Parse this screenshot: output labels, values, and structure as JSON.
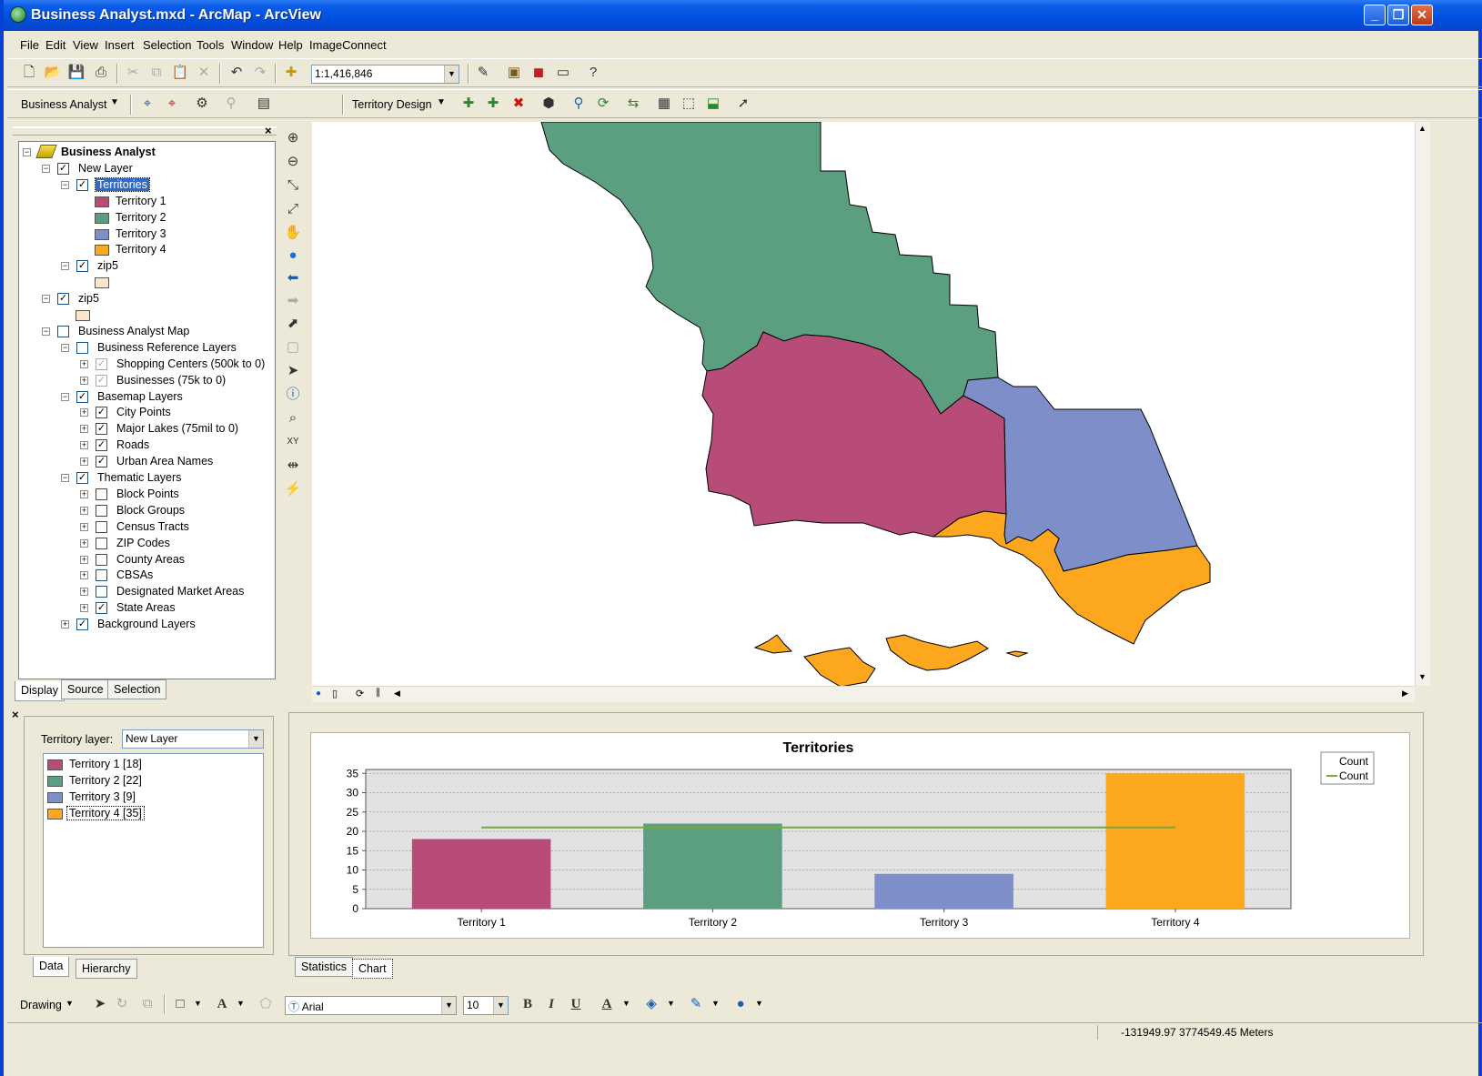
{
  "window": {
    "title": "Business Analyst.mxd - ArcMap - ArcView",
    "min": "_",
    "max": "❐",
    "close": "✕"
  },
  "menu": [
    "File",
    "Edit",
    "View",
    "Insert",
    "Selection",
    "Tools",
    "Window",
    "Help",
    "ImageConnect"
  ],
  "toolbar": {
    "scale": "1:1,416,846"
  },
  "ba_toolbar": {
    "label": "Business Analyst",
    "territory_design": "Territory Design"
  },
  "toc": {
    "rows": [
      {
        "indent": 0,
        "exp": "−",
        "chk": null,
        "icon": "layers",
        "label": "Business Analyst",
        "bold": true
      },
      {
        "indent": 1,
        "exp": "−",
        "chk": "checked",
        "label": "New Layer"
      },
      {
        "indent": 2,
        "exp": "−",
        "chk": "checked",
        "label": "Territories",
        "selected": true
      },
      {
        "indent": 3,
        "swatch": "#b84c78",
        "label": "Territory 1"
      },
      {
        "indent": 3,
        "swatch": "#5c9e80",
        "label": "Territory 2"
      },
      {
        "indent": 3,
        "swatch": "#7d8ec8",
        "label": "Territory 3"
      },
      {
        "indent": 3,
        "swatch": "#fca71d",
        "label": "Territory 4"
      },
      {
        "indent": 2,
        "exp": "−",
        "chk": "checked",
        "label": "zip5"
      },
      {
        "indent": 3,
        "swatch": "#f9e6cc",
        "label": ""
      },
      {
        "indent": 1,
        "exp": "−",
        "chk": "checked",
        "label": "zip5"
      },
      {
        "indent": 2,
        "swatch": "#f9e6cc",
        "label": ""
      },
      {
        "indent": 1,
        "exp": "−",
        "chk": "unchecked",
        "label": "Business Analyst Map"
      },
      {
        "indent": 2,
        "exp": "−",
        "chk": "unchecked",
        "label": "Business Reference Layers"
      },
      {
        "indent": 3,
        "exp": "+",
        "chk": "grey",
        "label": "Shopping Centers (500k to 0)"
      },
      {
        "indent": 3,
        "exp": "+",
        "chk": "grey",
        "label": "Businesses (75k to 0)"
      },
      {
        "indent": 2,
        "exp": "−",
        "chk": "checked",
        "label": "Basemap Layers"
      },
      {
        "indent": 3,
        "exp": "+",
        "chk": "checked",
        "label": "City Points"
      },
      {
        "indent": 3,
        "exp": "+",
        "chk": "checked",
        "label": "Major Lakes (75mil to 0)"
      },
      {
        "indent": 3,
        "exp": "+",
        "chk": "checked",
        "label": "Roads"
      },
      {
        "indent": 3,
        "exp": "+",
        "chk": "checked",
        "label": "Urban Area Names"
      },
      {
        "indent": 2,
        "exp": "−",
        "chk": "checked",
        "label": "Thematic Layers"
      },
      {
        "indent": 3,
        "exp": "+",
        "chk": "unchecked",
        "label": "Block Points"
      },
      {
        "indent": 3,
        "exp": "+",
        "chk": "unchecked",
        "label": "Block Groups"
      },
      {
        "indent": 3,
        "exp": "+",
        "chk": "unchecked",
        "label": "Census Tracts"
      },
      {
        "indent": 3,
        "exp": "+",
        "chk": "unchecked",
        "label": "ZIP Codes"
      },
      {
        "indent": 3,
        "exp": "+",
        "chk": "unchecked",
        "label": "County Areas"
      },
      {
        "indent": 3,
        "exp": "+",
        "chk": "unchecked",
        "label": "CBSAs"
      },
      {
        "indent": 3,
        "exp": "+",
        "chk": "unchecked",
        "label": "Designated Market Areas"
      },
      {
        "indent": 3,
        "exp": "+",
        "chk": "checked",
        "label": "State  Areas"
      },
      {
        "indent": 2,
        "exp": "+",
        "chk": "checked",
        "label": "Background Layers"
      }
    ],
    "tabs": [
      "Display",
      "Source",
      "Selection"
    ]
  },
  "territory_panel": {
    "label": "Territory layer:",
    "layer": "New Layer",
    "items": [
      {
        "label": "Territory 1 [18]",
        "color": "#b84c78"
      },
      {
        "label": "Territory 2 [22]",
        "color": "#5c9e80"
      },
      {
        "label": "Territory 3 [9]",
        "color": "#7d8ec8"
      },
      {
        "label": "Territory 4 [35]",
        "color": "#fca71d",
        "selected": true
      }
    ],
    "tabs": [
      "Data",
      "Hierarchy"
    ]
  },
  "chart_tabs": [
    "Statistics",
    "Chart"
  ],
  "chart_data": {
    "type": "bar",
    "title": "Territories",
    "categories": [
      "Territory 1",
      "Territory 2",
      "Territory 3",
      "Territory 4"
    ],
    "series": [
      {
        "name": "Count",
        "type": "bar",
        "values": [
          18,
          22,
          9,
          35
        ],
        "colors": [
          "#b84c78",
          "#5c9e80",
          "#7d8ec8",
          "#fca71d"
        ]
      },
      {
        "name": "Count",
        "type": "line",
        "values": [
          21,
          21,
          21,
          21
        ],
        "color": "#7aa63a"
      }
    ],
    "yticks": [
      0,
      5,
      10,
      15,
      20,
      25,
      30,
      35
    ],
    "ylim": [
      0,
      36
    ],
    "grid": true,
    "legend": "top-right"
  },
  "drawing": {
    "label": "Drawing",
    "font": "Arial",
    "size": "10",
    "bold": "B",
    "italic": "I",
    "underline": "U"
  },
  "status": {
    "coords": "-131949.97  3774549.45 Meters"
  },
  "colors": {
    "t1": "#b84c78",
    "t2": "#5c9e80",
    "t3": "#7d8ec8",
    "t4": "#fca71d"
  }
}
